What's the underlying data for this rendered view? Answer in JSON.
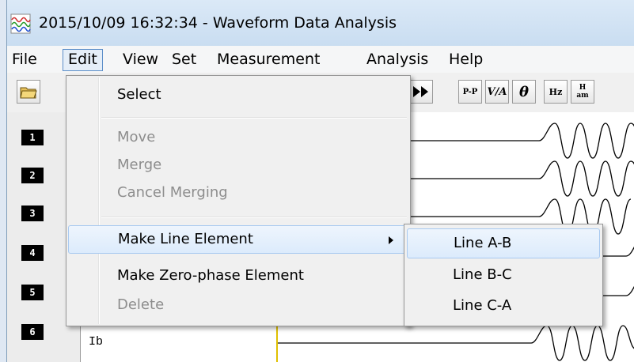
{
  "window": {
    "title": "2015/10/09 16:32:34  - Waveform Data Analysis",
    "app_icon": "waveform-app-icon"
  },
  "menubar": {
    "items": [
      {
        "label": "File"
      },
      {
        "label": "Edit"
      },
      {
        "label": "View"
      },
      {
        "label": "Set"
      },
      {
        "label": "Measurement"
      },
      {
        "label": "Analysis"
      },
      {
        "label": "Help"
      }
    ],
    "open_menu": "Edit"
  },
  "toolbar": {
    "buttons": [
      {
        "icon": "open-folder-icon"
      },
      {
        "icon": "fast-forward-icon",
        "glyph": "▶▶"
      },
      {
        "icon": "peak-to-peak-icon",
        "glyph": "P-P"
      },
      {
        "icon": "v-a-icon",
        "glyph": "V/A"
      },
      {
        "icon": "theta-icon",
        "glyph": "θ"
      },
      {
        "icon": "hz-icon",
        "glyph": "Hz"
      },
      {
        "icon": "harmonic-icon",
        "glyph": "H am"
      }
    ]
  },
  "channels": [
    "1",
    "2",
    "3",
    "4",
    "5",
    "6"
  ],
  "signal_names": {
    "ch6": "Ib"
  },
  "edit_menu": {
    "select": "Select",
    "move": "Move",
    "merge": "Merge",
    "cancel_merging": "Cancel Merging",
    "make_line_element": "Make Line Element",
    "make_zero_phase_element": "Make Zero-phase Element",
    "delete": "Delete"
  },
  "line_submenu": {
    "items": [
      "Line A-B",
      "Line B-C",
      "Line C-A"
    ],
    "highlighted": "Line A-B"
  },
  "colors": {
    "menu_highlight": "#dcebfc",
    "disabled_text": "#8d8d8d",
    "channel_badge": "#000000",
    "cursor_line": "#e0c000"
  }
}
